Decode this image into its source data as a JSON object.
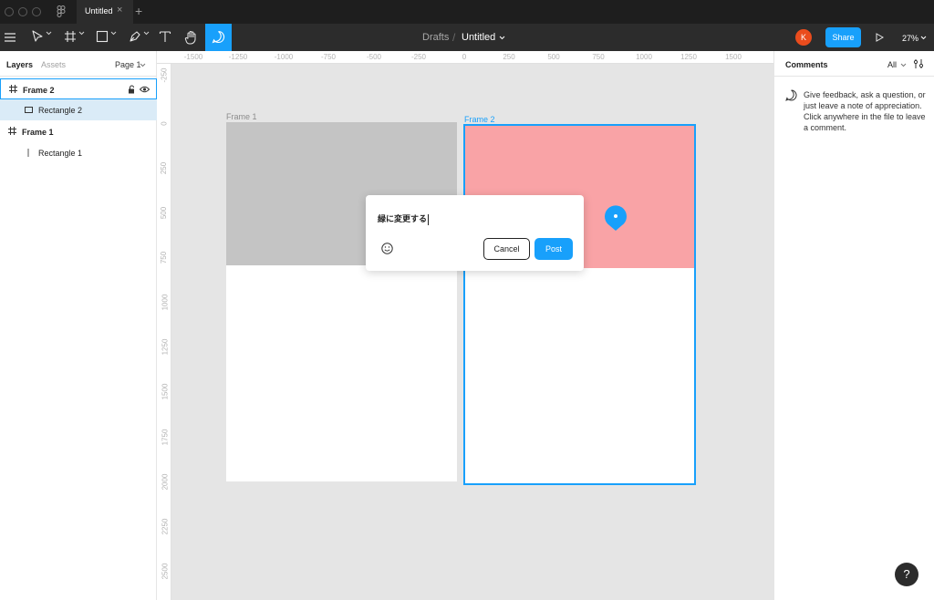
{
  "window": {
    "tab_title": "Untitled",
    "close_glyph": "×",
    "new_tab_glyph": "+"
  },
  "toolbar": {
    "breadcrumb_root": "Drafts",
    "breadcrumb_separator": "/",
    "file_title": "Untitled",
    "avatar_initial": "K",
    "share_label": "Share",
    "zoom_level": "27%",
    "accent_color": "#18a0fb"
  },
  "left_panel": {
    "tabs": [
      "Layers",
      "Assets"
    ],
    "page_selector": "Page 1",
    "layers": [
      {
        "name": "Frame 2",
        "type": "frame"
      },
      {
        "name": "Rectangle 2",
        "type": "rectangle",
        "selected": true
      },
      {
        "name": "Frame 1",
        "type": "frame"
      },
      {
        "name": "Rectangle 1",
        "type": "rectangle"
      }
    ]
  },
  "rulers": {
    "top": [
      "-1500",
      "-1250",
      "-1000",
      "-750",
      "-500",
      "-250",
      "0",
      "250",
      "500",
      "750",
      "1000",
      "1250",
      "1500"
    ],
    "left": [
      "-250",
      "0",
      "250",
      "500",
      "750",
      "1000",
      "1250",
      "1500",
      "1750",
      "2000",
      "2250",
      "2500"
    ]
  },
  "canvas": {
    "frame1_label": "Frame 1",
    "frame2_label": "Frame 2",
    "frame1_rect_color": "#c4c4c4",
    "frame2_rect_color": "#f9a3a6"
  },
  "comment_popup": {
    "text": "緑に変更する",
    "cancel_label": "Cancel",
    "post_label": "Post"
  },
  "right_panel": {
    "title": "Comments",
    "filter": "All",
    "hint": "Give feedback, ask a question, or just leave a note of appreciation. Click anywhere in the file to leave a comment."
  },
  "help": {
    "label": "?"
  }
}
